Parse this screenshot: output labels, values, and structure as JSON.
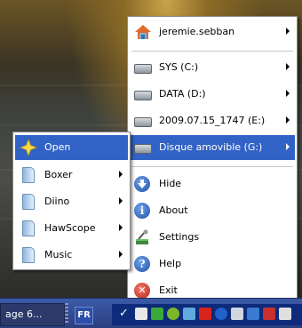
{
  "main_menu": {
    "items": [
      {
        "label": "jeremie.sebban",
        "icon": "home-icon",
        "submenu": true
      },
      {
        "label": "SYS (C:)",
        "icon": "drive-icon",
        "submenu": true
      },
      {
        "label": "DATA (D:)",
        "icon": "drive-icon",
        "submenu": true
      },
      {
        "label": "2009.07.15_1747 (E:)",
        "icon": "drive-icon",
        "submenu": true
      },
      {
        "label": "Disque amovible (G:)",
        "icon": "removable-drive-icon",
        "submenu": true,
        "highlighted": true
      },
      {
        "label": "Hide",
        "icon": "hide-icon"
      },
      {
        "label": "About",
        "icon": "info-icon"
      },
      {
        "label": "Settings",
        "icon": "settings-icon"
      },
      {
        "label": "Help",
        "icon": "help-icon"
      },
      {
        "label": "Exit",
        "icon": "exit-icon"
      }
    ]
  },
  "sub_menu": {
    "items": [
      {
        "label": "Open",
        "icon": "star-icon",
        "highlighted": true
      },
      {
        "label": "Boxer",
        "icon": "folder-icon",
        "submenu": true
      },
      {
        "label": "Diino",
        "icon": "folder-icon",
        "submenu": true
      },
      {
        "label": "HawScope",
        "icon": "folder-icon",
        "submenu": true
      },
      {
        "label": "Music",
        "icon": "folder-icon",
        "submenu": true
      }
    ]
  },
  "taskbar": {
    "task_label": "age 6...",
    "language": "FR"
  },
  "colors": {
    "highlight": "#3163c6",
    "taskbar": "#2a3f7d",
    "tray": "#0e2a7a"
  }
}
